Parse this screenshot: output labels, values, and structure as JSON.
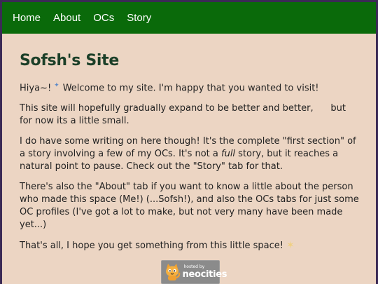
{
  "nav": {
    "items": [
      {
        "label": "Home"
      },
      {
        "label": "About"
      },
      {
        "label": "OCs"
      },
      {
        "label": "Story"
      }
    ]
  },
  "main": {
    "title": "Sofsh's Site",
    "greeting_start": "Hiya~!",
    "greeting_end": "Welcome to my site. I'm happy that you wanted to visit!",
    "p2": "This site will hopefully gradually expand to be better and better,      but for now its a little small.",
    "p3_a": "I do have some writing on here though! It's the complete \"first section\" of a story involving a few of my OCs. It's not a ",
    "p3_em": "full",
    "p3_b": " story, but it reaches a natural point to pause. Check out the \"Story\" tab for that.",
    "p4": "There's also the \"About\" tab if you want to know a little about the person who made this space (Me!) (...Sofsh!), and also the OCs tabs for just some OC profiles (I've got a lot to make, but not very many have been made yet...)",
    "p5": "That's all, I hope you get something from this little space!"
  },
  "badge": {
    "small": "hosted by",
    "big": "neocities"
  },
  "colors": {
    "nav_bg": "#0a6a0a",
    "page_bg": "#ecd5c3",
    "title": "#1b3f28",
    "border": "#3b2a55"
  }
}
